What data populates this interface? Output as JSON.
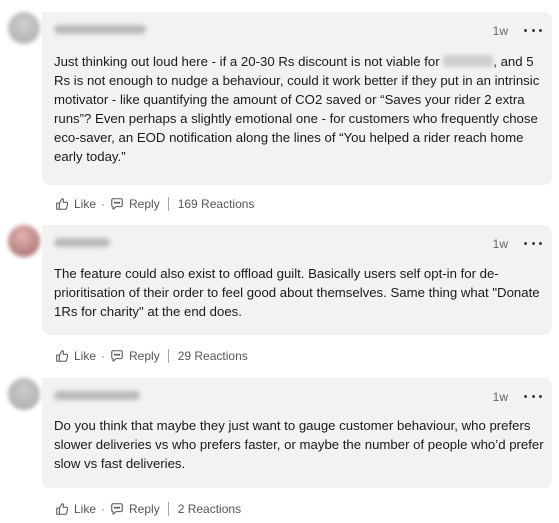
{
  "comments": [
    {
      "timestamp": "1w",
      "text_before": "Just thinking out loud here - if a 20-30 Rs discount is not viable for ",
      "text_after": ", and 5 Rs is not enough to nudge a behaviour, could it work better if they put in an intrinsic motivator - like quantifying the amount of CO2 saved or “Saves your rider 2 extra runs”?  Even perhaps a slightly emotional one - for customers who frequently chose eco-saver, an EOD notification along the lines of “You helped a rider reach home early today.”",
      "like_label": "Like",
      "reply_label": "Reply",
      "reactions": "169 Reactions"
    },
    {
      "timestamp": "1w",
      "text": "The feature could also exist to offload guilt. Basically users self opt-in for de-prioritisation of their order to feel good about themselves. Same thing what \"Donate 1Rs for charity\" at the end does.",
      "like_label": "Like",
      "reply_label": "Reply",
      "reactions": "29 Reactions"
    },
    {
      "timestamp": "1w",
      "text": "Do you think that maybe they just want to gauge customer behaviour, who prefers slower deliveries vs who prefers faster, or maybe the number of people who’d prefer slow vs fast deliveries.",
      "like_label": "Like",
      "reply_label": "Reply",
      "reactions": "2 Reactions"
    }
  ],
  "action_separator": "·",
  "icons": {
    "like": "thumbs-up-icon",
    "reply": "speech-bubble-icon",
    "more": "more-horizontal-icon"
  },
  "colors": {
    "bubble": "#f2f2f2",
    "meta_text": "#666666"
  }
}
